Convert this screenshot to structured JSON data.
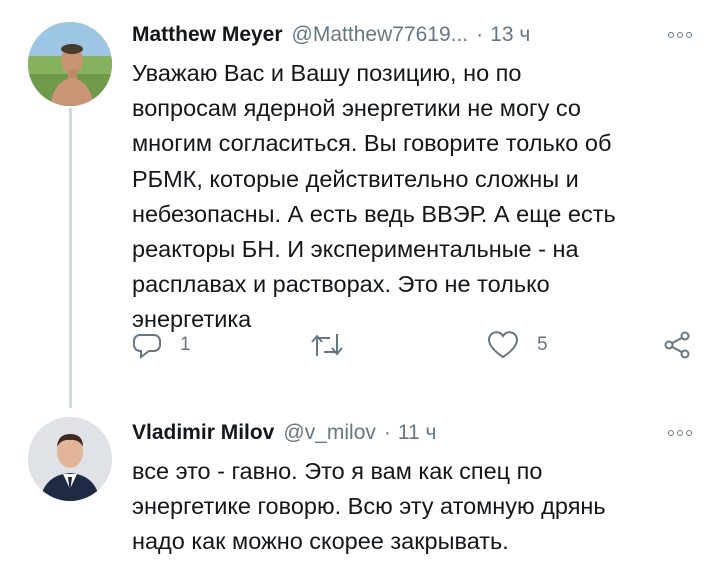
{
  "tweets": [
    {
      "author_name": "Matthew Meyer",
      "handle": "@Matthew77619...",
      "separator": "·",
      "time": "13 ч",
      "text_lines": [
        "Уважаю Вас и Вашу позицию, но по",
        "вопросам ядерной энергетики не могу со",
        "многим согласиться. Вы говорите только об",
        "РБМК, которые действительно сложны и",
        "небезопасны. А есть ведь ВВЭР. А еще есть",
        "реакторы БН. И экспериментальные - на",
        "расплавах и растворах. Это не только",
        "энергетика"
      ],
      "reply_count": "1",
      "like_count": "5"
    },
    {
      "author_name": "Vladimir Milov",
      "handle": "@v_milov",
      "separator": "·",
      "time": "11 ч",
      "text_lines": [
        "все это - гавно. Это я вам как спец по",
        "энергетике говорю. Всю эту атомную дрянь",
        "надо как можно скорее закрывать."
      ]
    }
  ],
  "icons": {
    "reply": "reply-icon",
    "retweet": "retweet-icon",
    "like": "heart-icon",
    "share": "share-icon",
    "more": "more-options-icon"
  },
  "colors": {
    "text": "#14171a",
    "secondary": "#657786",
    "thread_line": "#cfd9de"
  }
}
